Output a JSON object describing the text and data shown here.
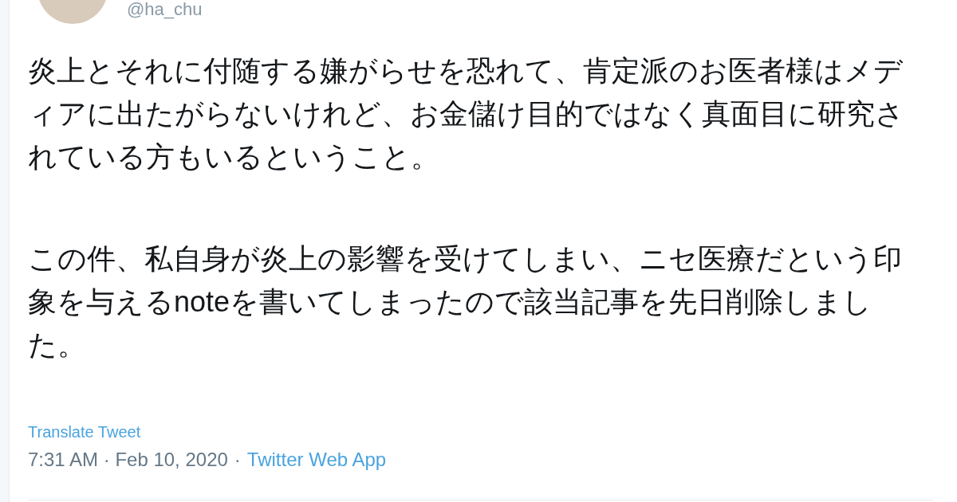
{
  "tweet": {
    "handle": "@ha_chu",
    "paragraphs": [
      "炎上とそれに付随する嫌がらせを恐れて、肯定派のお医者様はメディアに出たがらないけれど、お金儲け目的ではなく真面目に研究されている方もいるということ。",
      "この件、私自身が炎上の影響を受けてしまい、ニセ医療だという印象を与えるnoteを書いてしまったので該当記事を先日削除しました。"
    ],
    "translate_link": "Translate Tweet",
    "timestamp": "7:31 AM · Feb 10, 2020",
    "separator": "·",
    "source": "Twitter Web App"
  }
}
